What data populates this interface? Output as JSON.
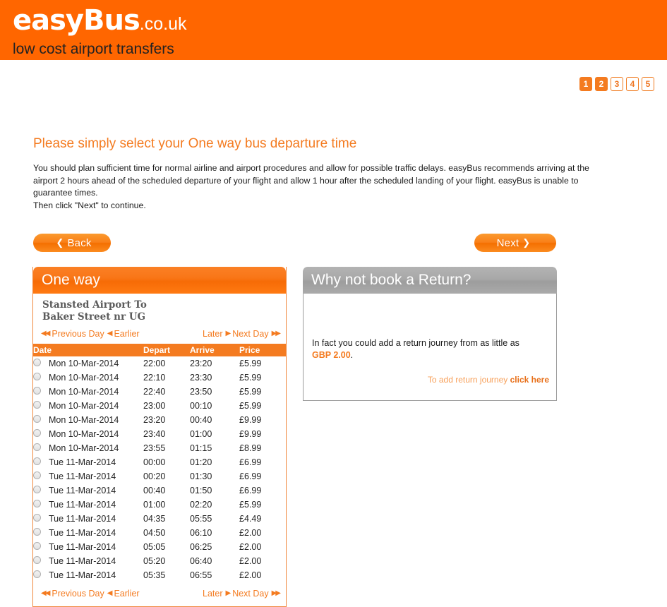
{
  "brand": {
    "name_main": "easyBus",
    "name_tld": ".co.uk",
    "tagline": "low cost airport transfers",
    "header_color": "#ff6600"
  },
  "steps": [
    {
      "label": "1",
      "active": true
    },
    {
      "label": "2",
      "active": true
    },
    {
      "label": "3",
      "active": false
    },
    {
      "label": "4",
      "active": false
    },
    {
      "label": "5",
      "active": false
    }
  ],
  "page": {
    "title": "Please simply select your One way bus departure time",
    "intro_line1": "You should plan sufficient time for normal airline and airport procedures and allow for possible traffic delays. easyBus recommends arriving at the airport 2 hours ahead of the scheduled departure of your flight and allow 1 hour after the scheduled landing of your flight. easyBus is unable to guarantee times.",
    "intro_line2": "Then click \"Next\" to continue.",
    "accent_color": "#f47b20"
  },
  "nav_buttons": {
    "back_label": "Back",
    "back_icon": "chevron-left",
    "next_label": "Next",
    "next_icon": "chevron-right"
  },
  "oneway_panel": {
    "header": "One way",
    "route_line1": "Stansted Airport To",
    "route_line2": "Baker Street nr UG",
    "daynav": {
      "previous_day": "Previous Day",
      "earlier": "Earlier",
      "later": "Later",
      "next_day": "Next Day",
      "prev_day_icon": "double-arrow-left",
      "earlier_icon": "arrow-left",
      "later_icon": "arrow-right",
      "next_day_icon": "double-arrow-right"
    },
    "columns": [
      "Date",
      "Depart",
      "Arrive",
      "Price"
    ],
    "rows": [
      {
        "date": "Mon 10-Mar-2014",
        "depart": "22:00",
        "arrive": "23:20",
        "price": "£5.99"
      },
      {
        "date": "Mon 10-Mar-2014",
        "depart": "22:10",
        "arrive": "23:30",
        "price": "£5.99"
      },
      {
        "date": "Mon 10-Mar-2014",
        "depart": "22:40",
        "arrive": "23:50",
        "price": "£5.99"
      },
      {
        "date": "Mon 10-Mar-2014",
        "depart": "23:00",
        "arrive": "00:10",
        "price": "£5.99"
      },
      {
        "date": "Mon 10-Mar-2014",
        "depart": "23:20",
        "arrive": "00:40",
        "price": "£9.99"
      },
      {
        "date": "Mon 10-Mar-2014",
        "depart": "23:40",
        "arrive": "01:00",
        "price": "£9.99"
      },
      {
        "date": "Mon 10-Mar-2014",
        "depart": "23:55",
        "arrive": "01:15",
        "price": "£8.99"
      },
      {
        "date": "Tue 11-Mar-2014",
        "depart": "00:00",
        "arrive": "01:20",
        "price": "£6.99"
      },
      {
        "date": "Tue 11-Mar-2014",
        "depart": "00:20",
        "arrive": "01:30",
        "price": "£6.99"
      },
      {
        "date": "Tue 11-Mar-2014",
        "depart": "00:40",
        "arrive": "01:50",
        "price": "£6.99"
      },
      {
        "date": "Tue 11-Mar-2014",
        "depart": "01:00",
        "arrive": "02:20",
        "price": "£5.99"
      },
      {
        "date": "Tue 11-Mar-2014",
        "depart": "04:35",
        "arrive": "05:55",
        "price": "£4.49"
      },
      {
        "date": "Tue 11-Mar-2014",
        "depart": "04:50",
        "arrive": "06:10",
        "price": "£2.00"
      },
      {
        "date": "Tue 11-Mar-2014",
        "depart": "05:05",
        "arrive": "06:25",
        "price": "£2.00"
      },
      {
        "date": "Tue 11-Mar-2014",
        "depart": "05:20",
        "arrive": "06:40",
        "price": "£2.00"
      },
      {
        "date": "Tue 11-Mar-2014",
        "depart": "05:35",
        "arrive": "06:55",
        "price": "£2.00"
      }
    ]
  },
  "return_panel": {
    "header": "Why not book a Return?",
    "body_text_before": "In fact you could add a return journey from as little as ",
    "price": "GBP 2.00",
    "body_text_after": ".",
    "link_prefix": "To add return journey ",
    "link_label": "click here"
  }
}
